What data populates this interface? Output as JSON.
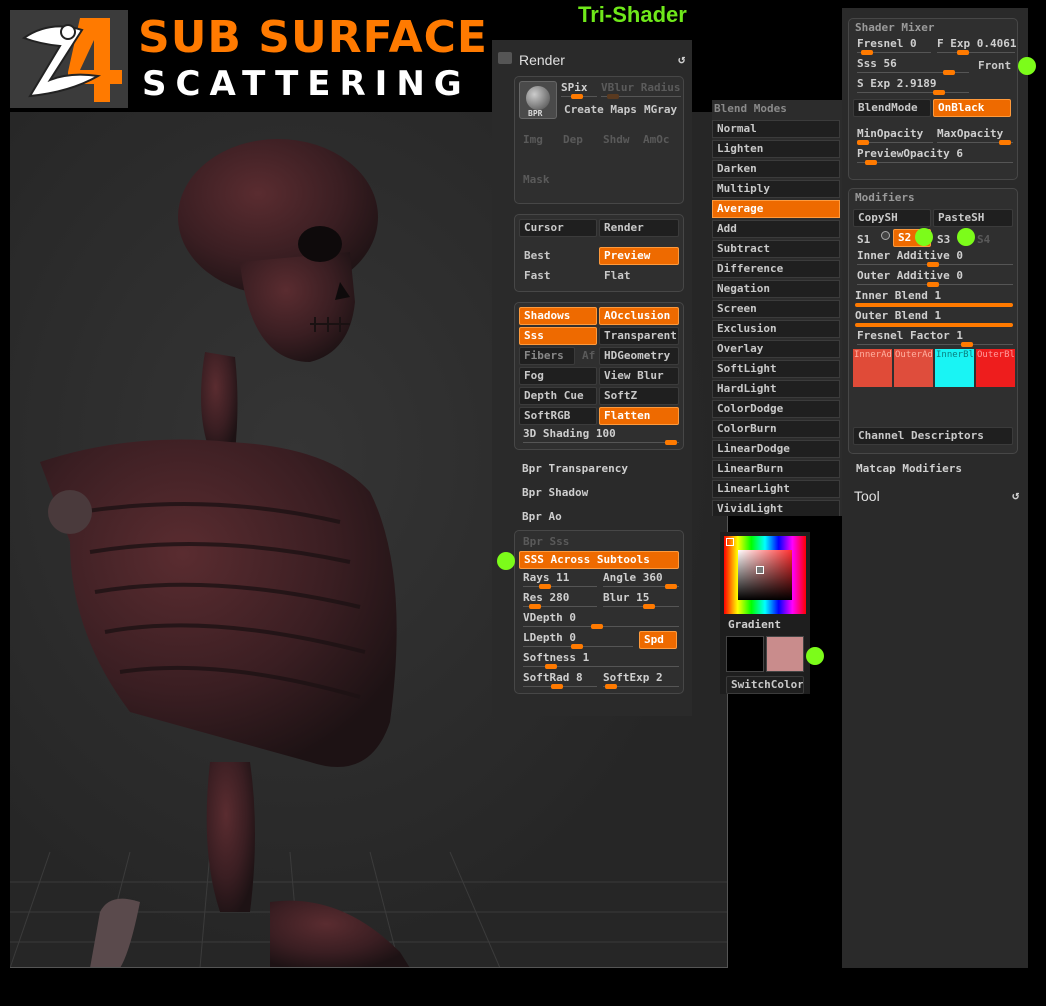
{
  "header": {
    "logo_text": "Z4",
    "title_line1": "SUB SURFACE",
    "title_line2": "SCATTERING",
    "tri_shader": "Tri-Shader"
  },
  "render_panel": {
    "title": "Render",
    "bpr_label": "BPR",
    "spix_label": "SPix",
    "vblur_label": "VBlur Radius",
    "create_maps": "Create Maps",
    "mgray": "MGray",
    "img": "Img",
    "dep": "Dep",
    "shdw": "Shdw",
    "amoc": "AmOc",
    "mask": "Mask",
    "cursor": "Cursor",
    "render": "Render",
    "best": "Best",
    "preview": "Preview",
    "fast": "Fast",
    "flat": "Flat",
    "shadows": "Shadows",
    "aocclusion": "AOcclusion",
    "sss": "Sss",
    "transparent": "Transparent",
    "fibers": "Fibers",
    "af": "Af",
    "hdgeometry": "HDGeometry",
    "fog": "Fog",
    "view_blur": "View Blur",
    "depth_cue": "Depth Cue",
    "softz": "SoftZ",
    "softrgb": "SoftRGB",
    "flatten": "Flatten",
    "shading_3d": "3D Shading 100",
    "bpr_transparency": "Bpr Transparency",
    "bpr_shadow": "Bpr Shadow",
    "bpr_ao": "Bpr Ao",
    "bpr_sss": "Bpr Sss",
    "sss_across": "SSS Across Subtools",
    "rays": "Rays 11",
    "angle": "Angle 360",
    "res": "Res 280",
    "blur": "Blur 15",
    "vdepth": "VDepth 0",
    "ldepth": "LDepth 0",
    "spd": "Spd",
    "softness": "Softness 1",
    "softrad": "SoftRad 8",
    "softexp": "SoftExp 2"
  },
  "blend_modes": {
    "title": "Blend Modes",
    "items": [
      "Normal",
      "Lighten",
      "Darken",
      "Multiply",
      "Average",
      "Add",
      "Subtract",
      "Difference",
      "Negation",
      "Screen",
      "Exclusion",
      "Overlay",
      "SoftLight",
      "HardLight",
      "ColorDodge",
      "ColorBurn",
      "LinearDodge",
      "LinearBurn",
      "LinearLight",
      "VividLight"
    ],
    "selected": "Average"
  },
  "color_picker": {
    "gradient": "Gradient",
    "switch_color": "SwitchColor",
    "main_color": "#000000",
    "secondary_color": "#c98c8c"
  },
  "shader_mixer": {
    "title": "Shader Mixer",
    "fresnel": "Fresnel 0",
    "f_exp": "F Exp 0.4061",
    "sss": "Sss 56",
    "front": "Front",
    "s_exp": "S Exp 2.9189",
    "blendmode": "BlendMode",
    "onblack": "OnBlack",
    "minopacity": "MinOpacity",
    "maxopacity": "MaxOpacity",
    "previewopacity": "PreviewOpacity 6"
  },
  "modifiers": {
    "title": "Modifiers",
    "copysh": "CopySH",
    "pastesh": "PasteSH",
    "s1": "S1",
    "s2": "S2",
    "s3": "S3",
    "s4": "S4",
    "inner_additive": "Inner Additive 0",
    "outer_additive": "Outer Additive 0",
    "inner_blend": "Inner Blend 1",
    "outer_blend": "Outer Blend 1",
    "fresnel_factor": "Fresnel Factor 1",
    "swatches": [
      {
        "label": "InnerAdd",
        "color": "#e04b38"
      },
      {
        "label": "OuterAdd",
        "color": "#df4d3c"
      },
      {
        "label": "InnerBle",
        "color": "#19f4f4"
      },
      {
        "label": "OuterBle",
        "color": "#ee1d1d"
      }
    ],
    "channel_descriptors": "Channel Descriptors",
    "matcap_modifiers": "Matcap Modifiers",
    "tool": "Tool"
  }
}
